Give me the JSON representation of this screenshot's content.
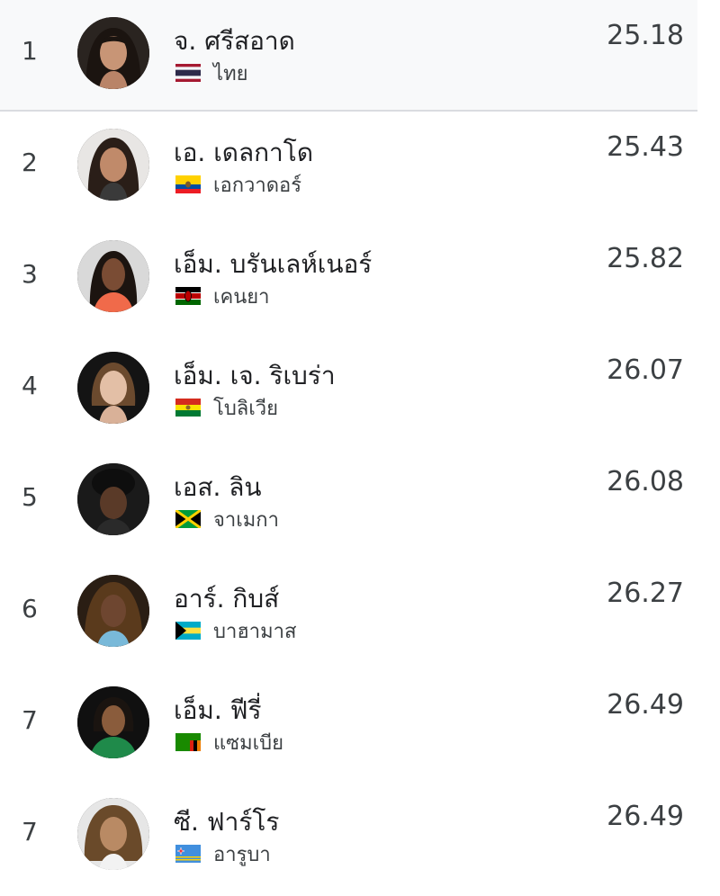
{
  "results": [
    {
      "rank": "1",
      "name": "จ. ศรีสอาด",
      "country": "ไทย",
      "time": "25.18",
      "flag": "thailand-flag",
      "highlight": true
    },
    {
      "rank": "2",
      "name": "เอ. เดลกาโด",
      "country": "เอกวาดอร์",
      "time": "25.43",
      "flag": "ecuador-flag",
      "highlight": false
    },
    {
      "rank": "3",
      "name": "เอ็ม. บรันเลห์เนอร์",
      "country": "เคนยา",
      "time": "25.82",
      "flag": "kenya-flag",
      "highlight": false
    },
    {
      "rank": "4",
      "name": "เอ็ม. เจ. ริเบร่า",
      "country": "โบลิเวีย",
      "time": "26.07",
      "flag": "bolivia-flag",
      "highlight": false
    },
    {
      "rank": "5",
      "name": "เอส. ลิน",
      "country": "จาเมกา",
      "time": "26.08",
      "flag": "jamaica-flag",
      "highlight": false
    },
    {
      "rank": "6",
      "name": "อาร์. กิบส์",
      "country": "บาฮามาส",
      "time": "26.27",
      "flag": "bahamas-flag",
      "highlight": false
    },
    {
      "rank": "7",
      "name": "เอ็ม. ฟีรี่",
      "country": "แซมเบีย",
      "time": "26.49",
      "flag": "zambia-flag",
      "highlight": false
    },
    {
      "rank": "7",
      "name": "ซี. ฟาร์โร",
      "country": "อารูบา",
      "time": "26.49",
      "flag": "aruba-flag",
      "highlight": false
    }
  ],
  "colors": {
    "highlight_bg": "#f8f9fa",
    "divider": "#dadce0",
    "text_primary": "#202124",
    "text_secondary": "#3c4043"
  }
}
